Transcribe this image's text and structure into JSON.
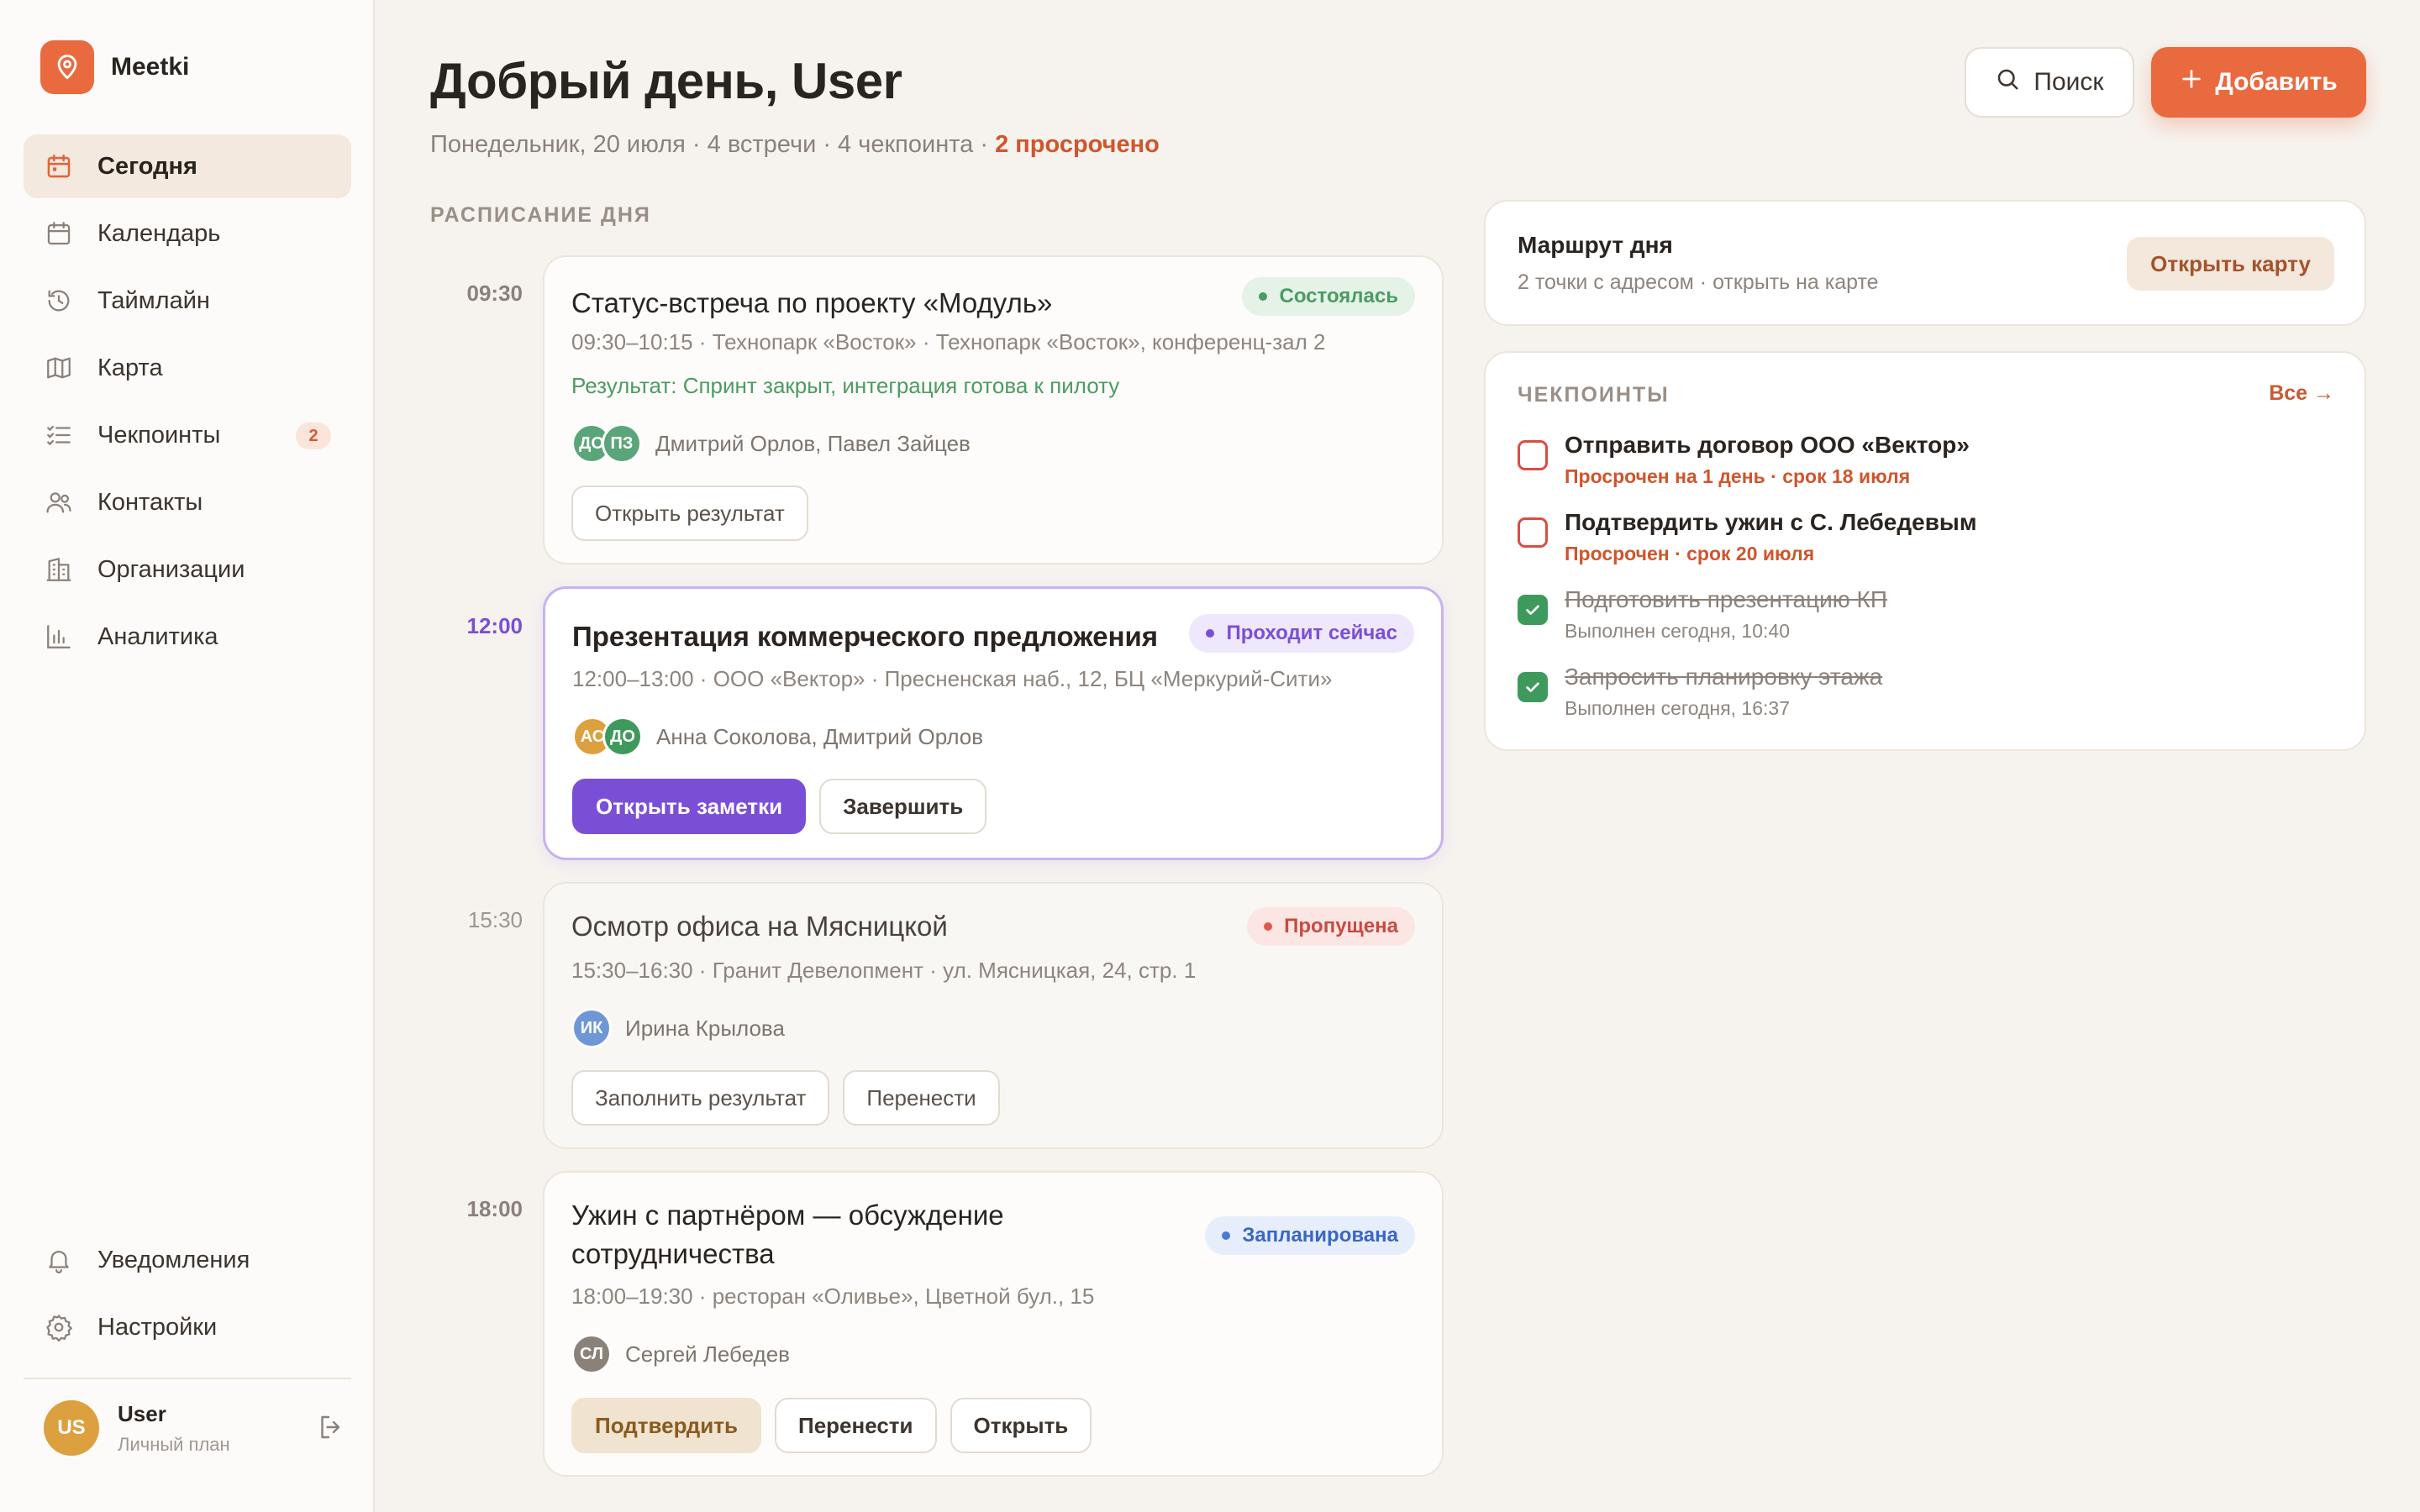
{
  "app": {
    "name": "Meetki"
  },
  "colors": {
    "accent": "#ea6a40",
    "live": "#7a4fd6",
    "success": "#4c9b63",
    "danger": "#c84a41",
    "info": "#3b66c4"
  },
  "sidebar": {
    "items": [
      {
        "label": "Сегодня",
        "icon": "calendar-today-icon",
        "active": true
      },
      {
        "label": "Календарь",
        "icon": "calendar-icon"
      },
      {
        "label": "Таймлайн",
        "icon": "history-icon"
      },
      {
        "label": "Карта",
        "icon": "map-icon"
      },
      {
        "label": "Чекпоинты",
        "icon": "checklist-icon",
        "badge": "2"
      },
      {
        "label": "Контакты",
        "icon": "users-icon"
      },
      {
        "label": "Организации",
        "icon": "building-icon"
      },
      {
        "label": "Аналитика",
        "icon": "bar-chart-icon"
      }
    ],
    "bottom": [
      {
        "label": "Уведомления",
        "icon": "bell-icon"
      },
      {
        "label": "Настройки",
        "icon": "gear-icon"
      }
    ],
    "user": {
      "initials": "US",
      "name": "User",
      "plan": "Личный план"
    }
  },
  "header": {
    "greeting": "Добрый день, User",
    "subtitle": "Понедельник, 20 июля · 4 встречи · 4 чекпоинта · ",
    "overdue": "2 просрочено",
    "search_label": "Поиск",
    "add_label": "Добавить"
  },
  "schedule": {
    "label": "РАСПИСАНИЕ ДНЯ",
    "events": [
      {
        "time": "09:30",
        "title": "Статус-встреча по проекту «Модуль»",
        "status": "Состоялась",
        "meta": "09:30–10:15 · Технопарк «Восток» · Технопарк «Восток», конференц-зал 2",
        "result": "Результат: Спринт закрыт, интеграция готова к пилоту",
        "avatars": [
          {
            "initials": "ДО",
            "color": "#5aa57a"
          },
          {
            "initials": "ПЗ",
            "color": "#5aa57a"
          }
        ],
        "attendees": "Дмитрий Орлов, Павел Зайцев",
        "buttons": [
          "Открыть результат"
        ]
      },
      {
        "time": "12:00",
        "title": "Презентация коммерческого предложения",
        "status": "Проходит сейчас",
        "meta": "12:00–13:00 · ООО «Вектор» · Пресненская наб., 12, БЦ «Меркурий-Сити»",
        "avatars": [
          {
            "initials": "АС",
            "color": "#dca03e"
          },
          {
            "initials": "ДО",
            "color": "#3e9a5c"
          }
        ],
        "attendees": "Анна Соколова, Дмитрий Орлов",
        "buttons": [
          "Открыть заметки",
          "Завершить"
        ]
      },
      {
        "time": "15:30",
        "title": "Осмотр офиса на Мясницкой",
        "status": "Пропущена",
        "meta": "15:30–16:30 · Гранит Девелопмент · ул. Мясницкая, 24, стр. 1",
        "avatars": [
          {
            "initials": "ИК",
            "color": "#6f97d6"
          }
        ],
        "attendees": "Ирина Крылова",
        "buttons": [
          "Заполнить результат",
          "Перенести"
        ]
      },
      {
        "time": "18:00",
        "title_line1": "Ужин с партнёром — обсуждение",
        "title_line2": "сотрудничества",
        "status": "Запланирована",
        "meta": "18:00–19:30 · ресторан «Оливье», Цветной бул., 15",
        "avatars": [
          {
            "initials": "СЛ",
            "color": "#8a8178"
          }
        ],
        "attendees": "Сергей Лебедев",
        "buttons": [
          "Подтвердить",
          "Перенести",
          "Открыть"
        ]
      }
    ]
  },
  "route": {
    "title": "Маршрут дня",
    "subtitle": "2 точки с адресом · открыть на карте",
    "button": "Открыть карту"
  },
  "checkpoints": {
    "title": "ЧЕКПОИНТЫ",
    "all_link": "Все →",
    "items": [
      {
        "text": "Отправить договор ООО «Вектор»",
        "sub": "Просрочен на 1 день · срок 18 июля",
        "done": false
      },
      {
        "text": "Подтвердить ужин с С. Лебедевым",
        "sub": "Просрочен · срок 20 июля",
        "done": false
      },
      {
        "text": "Подготовить презентацию КП",
        "sub": "Выполнен сегодня, 10:40",
        "done": true
      },
      {
        "text": "Запросить планировку этажа",
        "sub": "Выполнен сегодня, 16:37",
        "done": true
      }
    ]
  }
}
